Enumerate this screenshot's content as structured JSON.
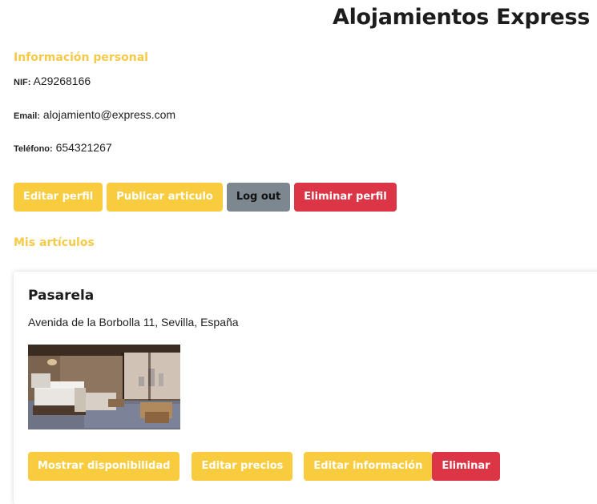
{
  "profile": {
    "company_name": "Alojamientos Express",
    "section_heading": "Información personal",
    "nif_label": "NIF:",
    "nif_value": "A29268166",
    "email_label": "Email:",
    "email_value": "alojamiento@express.com",
    "phone_label": "Teléfono:",
    "phone_value": "654321267"
  },
  "actions": {
    "edit_profile": "Editar perfil",
    "publish_article": "Publicar articulo",
    "logout": "Log out",
    "delete_profile": "Eliminar perfil"
  },
  "articles": {
    "heading": "Mis artículos",
    "items": [
      {
        "title": "Pasarela",
        "address": "Avenida de la Borbolla 11, Sevilla, España",
        "image_alt": "hotel room photo",
        "buttons": {
          "availability": "Mostrar disponibilidad",
          "prices": "Editar precios",
          "info": "Editar información",
          "delete": "Eliminar"
        }
      }
    ]
  },
  "colors": {
    "accent_yellow": "#f9cb3e",
    "heading_yellow": "#f7c948",
    "danger_red": "#dc3545",
    "neutral_grey": "#7d8790"
  }
}
